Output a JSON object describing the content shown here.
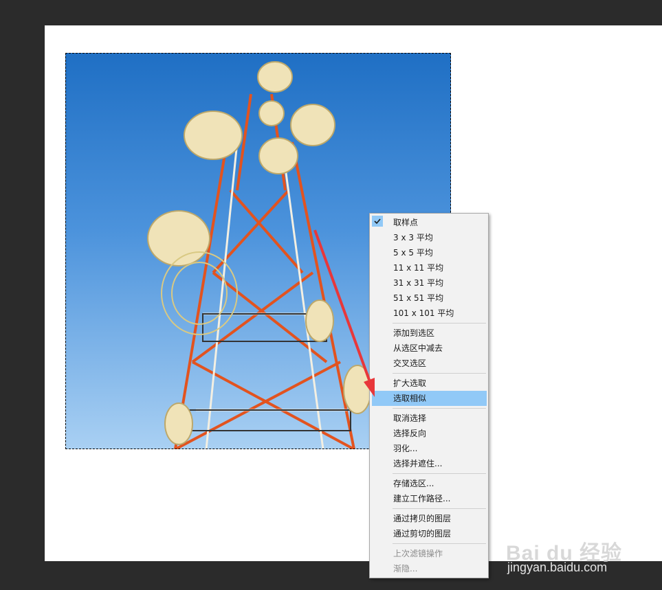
{
  "context_menu": {
    "items": [
      {
        "label": "取样点",
        "checked": true
      },
      {
        "label": "3 x 3 平均"
      },
      {
        "label": "5 x 5 平均"
      },
      {
        "label": "11 x 11 平均"
      },
      {
        "label": "31 x 31 平均"
      },
      {
        "label": "51 x 51 平均"
      },
      {
        "label": "101 x 101 平均"
      },
      {
        "label": "添加到选区"
      },
      {
        "label": "从选区中减去"
      },
      {
        "label": "交叉选区"
      },
      {
        "label": "扩大选取"
      },
      {
        "label": "选取相似",
        "highlighted": true
      },
      {
        "label": "取消选择"
      },
      {
        "label": "选择反向"
      },
      {
        "label": "羽化..."
      },
      {
        "label": "选择并遮住..."
      },
      {
        "label": "存储选区..."
      },
      {
        "label": "建立工作路径..."
      },
      {
        "label": "通过拷贝的图层"
      },
      {
        "label": "通过剪切的图层"
      },
      {
        "label": "上次滤镜操作",
        "disabled": true
      },
      {
        "label": "渐隐...",
        "disabled": true
      }
    ]
  },
  "watermark": {
    "logo": "Bai du 经验",
    "url": "jingyan.baidu.com"
  },
  "colors": {
    "workspace": "#2b2b2b",
    "menu_bg": "#f2f2f2",
    "highlight": "#91c9f7",
    "arrow": "#e8373a"
  }
}
